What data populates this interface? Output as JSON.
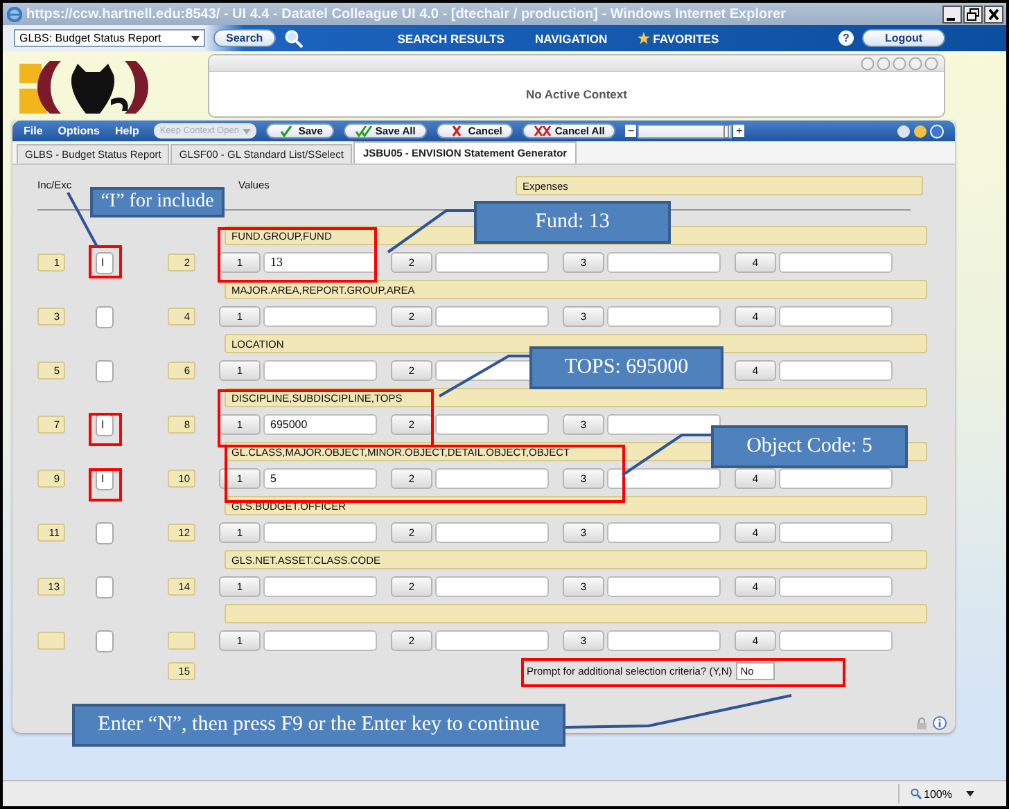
{
  "window": {
    "title": "https://ccw.hartnell.edu:8543/ - UI 4.4 - Datatel Colleague UI 4.0 - [dtechair / production] - Windows Internet Explorer"
  },
  "nav_bar": {
    "context_select": "GLBS: Budget Status Report",
    "search_button": "Search",
    "links": [
      "SEARCH RESULTS",
      "NAVIGATION",
      "FAVORITES"
    ],
    "help": "?",
    "logout": "Logout"
  },
  "context_panel": {
    "message": "No Active Context"
  },
  "menu_bar": {
    "menus": [
      "File",
      "Options",
      "Help"
    ],
    "context_dropdown": {
      "label": "Keep Context Open",
      "disabled": true
    },
    "buttons": [
      {
        "label": "Save",
        "kind": "check"
      },
      {
        "label": "Save All",
        "kind": "double-check"
      },
      {
        "label": "Cancel",
        "kind": "cross"
      },
      {
        "label": "Cancel All",
        "kind": "double-cross"
      }
    ],
    "zoom_slider": {
      "minus": "−",
      "plus": "+",
      "level": 0.95
    }
  },
  "tabs": [
    {
      "label": "GLBS - Budget Status Report",
      "selected": false
    },
    {
      "label": "GLSF00 - GL Standard List/SSelect",
      "selected": false
    },
    {
      "label": "JSBU05 - ENVISION Statement Generator",
      "selected": true
    }
  ],
  "form": {
    "inc_exc_heading": "Inc/Exc",
    "values_heading": "Values",
    "expenses": "Expenses",
    "rows": [
      {
        "number": "1",
        "include": "I",
        "field_number": "2",
        "field": "FUND.GROUP,FUND",
        "values": [
          {
            "button": "1",
            "value": "13"
          },
          {
            "button": "2"
          },
          {
            "button": "3"
          },
          {
            "button": "4"
          }
        ]
      },
      {
        "number": "3",
        "field_number": "4",
        "field": "MAJOR.AREA,REPORT.GROUP,AREA",
        "values": [
          {
            "button": "1"
          },
          {
            "button": "2"
          },
          {
            "button": "3"
          },
          {
            "button": "4"
          }
        ]
      },
      {
        "number": "5",
        "field_number": "6",
        "field": "LOCATION",
        "values": [
          {
            "button": "1"
          },
          {
            "button": "2"
          },
          {
            "kind": "covered"
          },
          {
            "button": "4"
          }
        ]
      },
      {
        "number": "7",
        "include": "I",
        "field_number": "8",
        "field": "DISCIPLINE,SUBDISCIPLINE,TOPS",
        "values": [
          {
            "button": "1",
            "value": "695000"
          },
          {
            "button": "2"
          },
          {
            "button": "3"
          },
          {
            "kind": "covered"
          }
        ]
      },
      {
        "number": "9",
        "include": "I",
        "field_number": "10",
        "field": "GL.CLASS,MAJOR.OBJECT,MINOR.OBJECT,DETAIL.OBJECT,OBJECT",
        "values": [
          {
            "button": "1",
            "value": "5"
          },
          {
            "button": "2"
          },
          {
            "button": "3"
          },
          {
            "button": "4"
          }
        ]
      },
      {
        "number": "11",
        "field_number": "12",
        "field": "GLS.BUDGET.OFFICER",
        "values": [
          {
            "button": "1"
          },
          {
            "button": "2"
          },
          {
            "button": "3"
          },
          {
            "button": "4"
          }
        ]
      },
      {
        "number": "13",
        "field_number": "14",
        "field": "GLS.NET.ASSET.CLASS.CODE",
        "values": [
          {
            "button": "1"
          },
          {
            "button": "2"
          },
          {
            "button": "3"
          },
          {
            "button": "4"
          }
        ]
      },
      {
        "values": [
          {
            "button": "1"
          },
          {
            "button": "2"
          },
          {
            "button": "3"
          },
          {
            "button": "4"
          }
        ]
      }
    ],
    "last_number": "15",
    "prompt": {
      "label": "Prompt for additional selection criteria? (Y,N)",
      "value": "No"
    }
  },
  "callouts": [
    "“I” for include",
    "Fund: 13",
    "TOPS: 695000",
    "Object Code: 5",
    "Enter “N”, then press F9 or the Enter key to continue"
  ],
  "status_bar": {
    "zoom": "100%"
  }
}
